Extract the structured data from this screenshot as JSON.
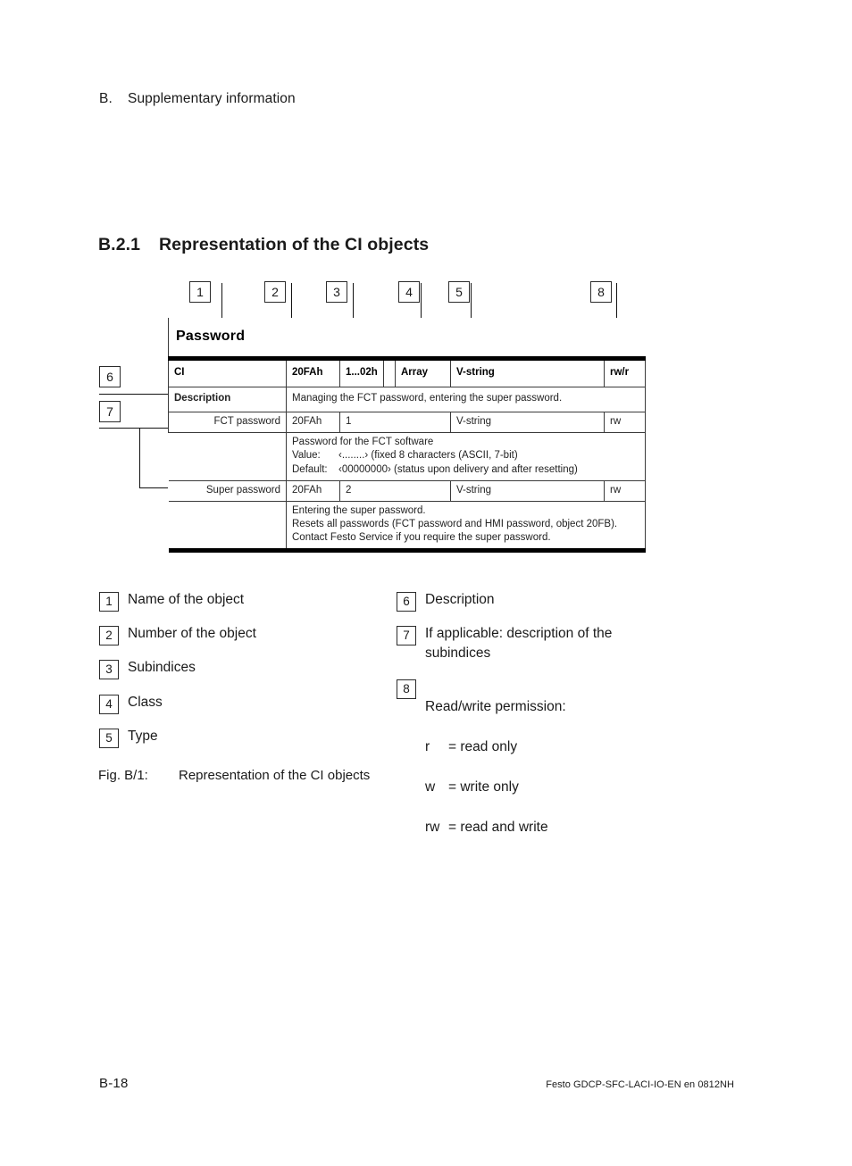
{
  "running_head": {
    "letter": "B.",
    "text": "Supplementary information"
  },
  "section": {
    "number": "B.2.1",
    "title": "Representation of the CI objects"
  },
  "figure": {
    "callout_labels": [
      "1",
      "2",
      "3",
      "4",
      "5",
      "6",
      "7",
      "8"
    ],
    "table": {
      "object_name": "Password",
      "header_row": {
        "name": "CI",
        "number": "20FAh",
        "subindices": "1...02h",
        "class": "Array",
        "type": "V-string",
        "permission": "rw/r"
      },
      "description_row": {
        "label": "Description",
        "text": "Managing the FCT password, entering the super password."
      },
      "subindices": [
        {
          "label": "FCT password",
          "number": "20FAh",
          "index": "1",
          "type": "V-string",
          "permission": "rw",
          "detail_lines": [
            "Password for the FCT software",
            "Value:",
            "‹........› (fixed 8 characters (ASCII, 7-bit)",
            "Default:",
            "‹00000000› (status upon delivery and after resetting)"
          ]
        },
        {
          "label": "Super password",
          "number": "20FAh",
          "index": "2",
          "type": "V-string",
          "permission": "rw",
          "detail_lines": [
            "Entering the super password.",
            "Resets all passwords (FCT password and HMI password, object 20FB).",
            "Contact Festo Service if you require the super password."
          ]
        }
      ]
    }
  },
  "legend": {
    "left": [
      {
        "num": "1",
        "text": "Name of the object"
      },
      {
        "num": "2",
        "text": "Number of the object"
      },
      {
        "num": "3",
        "text": "Subindices"
      },
      {
        "num": "4",
        "text": "Class"
      },
      {
        "num": "5",
        "text": "Type"
      }
    ],
    "right": [
      {
        "num": "6",
        "text": "Description"
      },
      {
        "num": "7",
        "text": "If applicable: description of the\nsubindices"
      },
      {
        "num": "8",
        "text": "Read/write permission:"
      }
    ],
    "permissions": [
      {
        "key": "r",
        "value": "= read only"
      },
      {
        "key": "w",
        "value": "= write only"
      },
      {
        "key": "rw",
        "value": "= read and write"
      }
    ]
  },
  "caption": {
    "tag": "Fig. B/1:",
    "text": "Representation of the CI objects"
  },
  "footer": {
    "page": "B-18",
    "reference": "Festo  GDCP-SFC-LACI-IO-EN  en 0812NH"
  }
}
